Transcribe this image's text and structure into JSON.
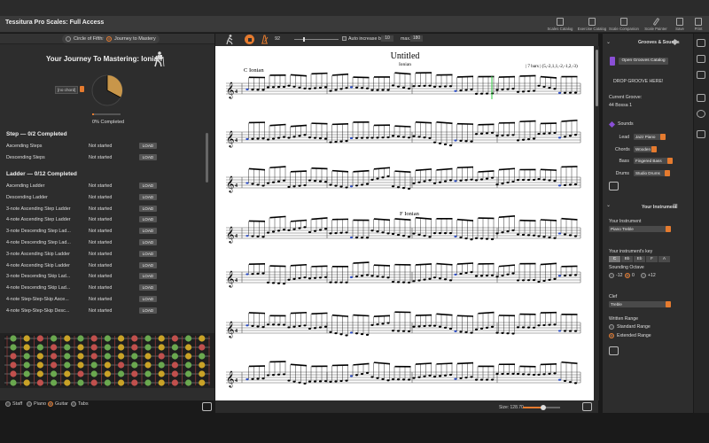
{
  "app": {
    "title": "Tessitura Pro Scales: Full Access"
  },
  "toolbar": [
    {
      "label": "Scales Catalog",
      "icon": "document-icon"
    },
    {
      "label": "Exercise Catalog",
      "icon": "exercise-icon"
    },
    {
      "label": "Scale Companion",
      "icon": "companion-icon"
    },
    {
      "label": "Scale Painter",
      "icon": "brush-icon"
    },
    {
      "label": "Save",
      "icon": "save-icon"
    },
    {
      "label": "Print",
      "icon": "print-icon"
    }
  ],
  "left": {
    "tabs": [
      {
        "label": "Circle of Fifths",
        "selected": false
      },
      {
        "label": "Journey to Mastery",
        "selected": true
      }
    ],
    "journey_title": "Your Journey To Mastering: Ionian",
    "chord_label": "[no chord]",
    "progress_text": "0% Completed",
    "progress_value": 0.06,
    "sections": [
      {
        "title": "Step — 0/2 Completed",
        "rows": [
          {
            "name": "Ascending Steps",
            "status": "Not started",
            "action": "LOAD"
          },
          {
            "name": "Descending Steps",
            "status": "Not started",
            "action": "LOAD"
          }
        ]
      },
      {
        "title": "Ladder — 0/12 Completed",
        "rows": [
          {
            "name": "Ascending Ladder",
            "status": "Not started",
            "action": "LOAD"
          },
          {
            "name": "Descending Ladder",
            "status": "Not started",
            "action": "LOAD"
          },
          {
            "name": "3-note Ascending Step Ladder",
            "status": "Not started",
            "action": "LOAD"
          },
          {
            "name": "4-note Ascending Step Ladder",
            "status": "Not started",
            "action": "LOAD"
          },
          {
            "name": "3-note Descending Step Lad...",
            "status": "Not started",
            "action": "LOAD"
          },
          {
            "name": "4-note Descending Step Lad...",
            "status": "Not started",
            "action": "LOAD"
          },
          {
            "name": "3-note Ascending Skip Ladder",
            "status": "Not started",
            "action": "LOAD"
          },
          {
            "name": "4-note Ascending Skip Ladder",
            "status": "Not started",
            "action": "LOAD"
          },
          {
            "name": "3-note Descending Skip Lad...",
            "status": "Not started",
            "action": "LOAD"
          },
          {
            "name": "4-note Descending Skip Lad...",
            "status": "Not started",
            "action": "LOAD"
          },
          {
            "name": "4-note Step-Step-Skip Asce...",
            "status": "Not started",
            "action": "LOAD"
          },
          {
            "name": "4-note Step-Step-Skip Desc...",
            "status": "Not started",
            "action": "LOAD"
          }
        ]
      }
    ],
    "instrument_tabs": [
      {
        "label": "Staff",
        "selected": false
      },
      {
        "label": "Piano",
        "selected": false
      },
      {
        "label": "Guitar",
        "selected": true
      },
      {
        "label": "Tabs",
        "selected": false
      }
    ]
  },
  "center": {
    "tempo": "92",
    "auto_increase_label": "Auto increase by",
    "auto_increase_value": "10",
    "max_label": "max.",
    "max_value": "180",
    "size_label": "Size: 128.70",
    "size_value": 0.55,
    "score": {
      "title": "Untitled",
      "subtitle": "Ionian",
      "section_1": "C Ionian",
      "section_2": "F Ionian",
      "bars_note": "| 7 bars | (5,-2,1,1,-2,-1,2,-3)"
    }
  },
  "right": {
    "grooves_header": "Grooves & Sounds",
    "open_grooves": "Open Grooves Catalog",
    "drop_groove": "DROP GROOVE HERE!",
    "current_groove_label": "Current Groove:",
    "current_groove_value": "44 Bossa 1",
    "sounds_label": "Sounds",
    "sounds": [
      {
        "role": "Lead",
        "value": "Jazz Piano"
      },
      {
        "role": "Chords",
        "value": "Wooden"
      },
      {
        "role": "Bass",
        "value": "Fingered Bass"
      },
      {
        "role": "Drums",
        "value": "Studio Drums"
      }
    ],
    "instrument_header": "Your Instrument",
    "instrument_label": "Your Instrument",
    "instrument_value": "Piano Treble",
    "key_label": "Your instrument's key",
    "keys": [
      "C",
      "Bb",
      "Eb",
      "F",
      "A"
    ],
    "octave_label": "Sounding Octave",
    "octaves": [
      {
        "label": "-12",
        "selected": false
      },
      {
        "label": "0",
        "selected": true
      },
      {
        "label": "+12",
        "selected": false
      }
    ],
    "clef_label": "Clef",
    "clef_value": "Treble",
    "range_label": "Written Range",
    "ranges": [
      {
        "label": "Standard Range",
        "selected": false
      },
      {
        "label": "Extended Range",
        "selected": true
      }
    ]
  },
  "colors": {
    "accent": "#e57b2f",
    "purple": "#8a4fd6",
    "panel": "#2d2d2d"
  }
}
